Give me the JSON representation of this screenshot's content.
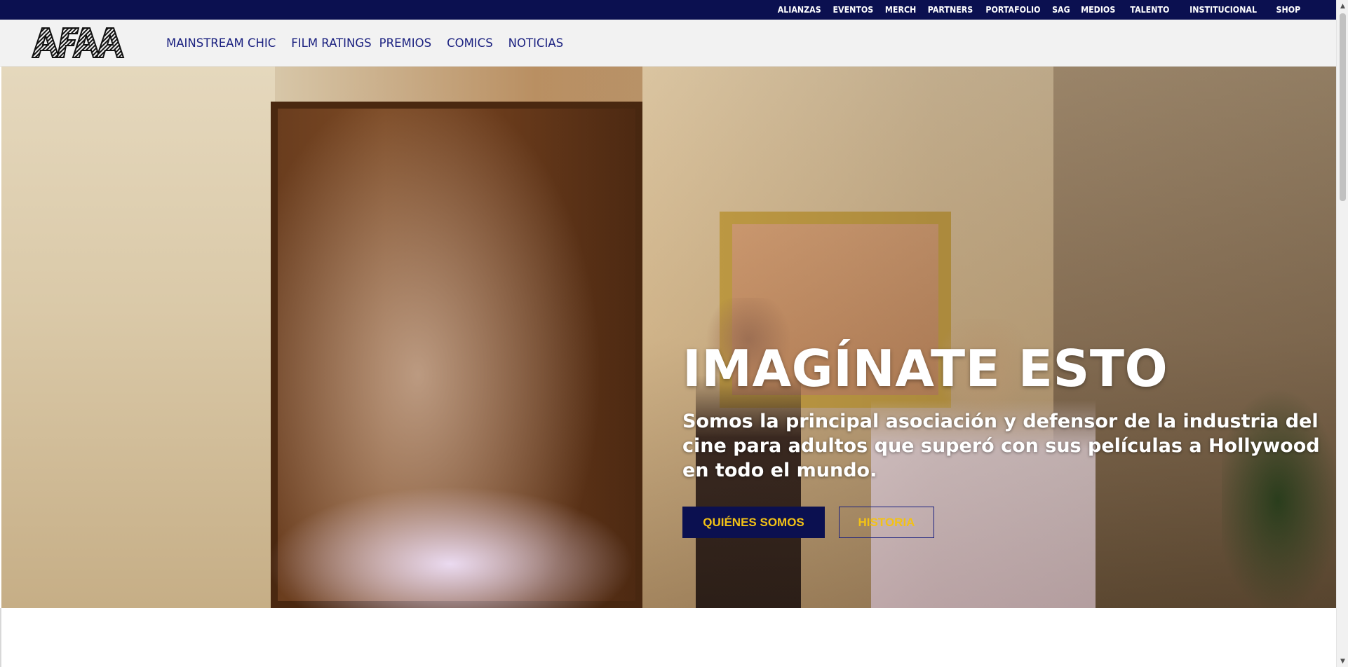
{
  "topbar": {
    "links": [
      "ALIANZAS",
      "EVENTOS",
      "MERCH",
      "PARTNERS",
      "PORTAFOLIO",
      "SAG",
      "MEDIOS",
      "TALENTO",
      "INSTITUCIONAL",
      "SHOP"
    ]
  },
  "navbar": {
    "logo_text": "AFAA",
    "items": [
      "MAINSTREAM CHIC",
      "FILM RATINGS",
      "PREMIOS",
      "COMICS",
      "NOTICIAS"
    ]
  },
  "hero": {
    "title": "IMAGÍNATE ESTO",
    "subtitle": "Somos la principal asociación y defensor de la industria del cine para adultos que superó con sus películas a Hollywood en todo el mundo.",
    "primary_button": "QUIÉNES SOMOS",
    "secondary_button": "HISTORIA"
  },
  "colors": {
    "topbar_bg": "#0b1050",
    "nav_text": "#1b2180",
    "button_text": "#f3c215",
    "navbar_bg": "#f2f2f2"
  }
}
